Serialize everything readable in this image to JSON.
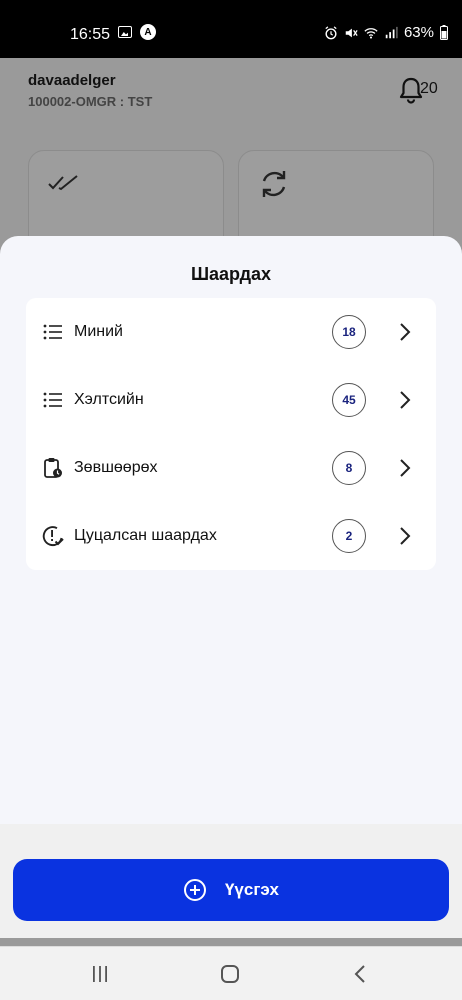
{
  "status_bar": {
    "time": "16:55",
    "battery": "63%"
  },
  "header": {
    "user_name": "davaadelger",
    "user_code": "100002-OMGR : TST",
    "notification_count": "20"
  },
  "sheet": {
    "title": "Шаардах",
    "items": [
      {
        "label": "Миний",
        "count": "18",
        "icon": "list-icon"
      },
      {
        "label": "Хэлтсийн",
        "count": "45",
        "icon": "list-icon"
      },
      {
        "label": "Зөвшөөрөх",
        "count": "8",
        "icon": "clipboard-clock-icon"
      },
      {
        "label": "Цуцалсан шаардах",
        "count": "2",
        "icon": "alert-check-icon"
      }
    ],
    "create_button_label": "Үүсгэх"
  },
  "colors": {
    "primary": "#0a33e0",
    "badge_text": "#1a237e"
  }
}
